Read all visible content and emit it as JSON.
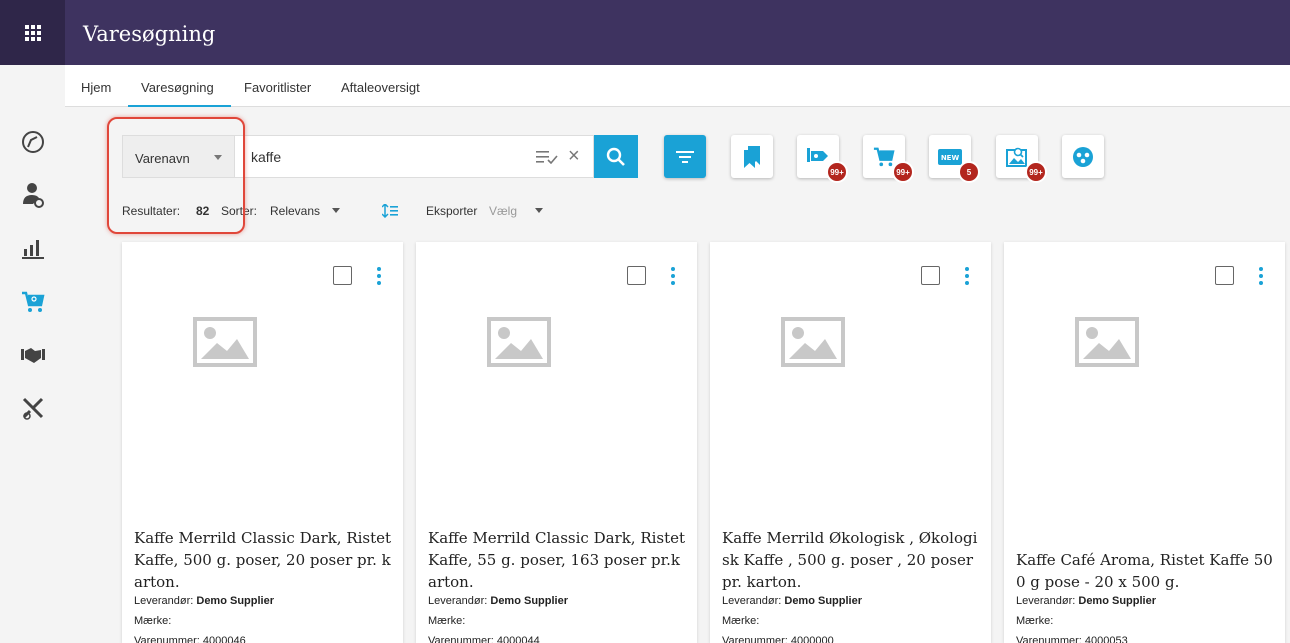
{
  "header": {
    "title": "Varesøgning"
  },
  "tabs": [
    {
      "label": "Hjem"
    },
    {
      "label": "Varesøgning"
    },
    {
      "label": "Favoritlister"
    },
    {
      "label": "Aftaleoversigt"
    }
  ],
  "search": {
    "field_select": "Varenavn",
    "query": "kaffe"
  },
  "results": {
    "label": "Resultater:",
    "count": "82",
    "sort_label": "Sorter:",
    "sort_value": "Relevans",
    "export_label": "Eksporter",
    "export_value": "Vælg"
  },
  "toolbar_badges": {
    "tag": "99+",
    "cart": "99+",
    "new": "5",
    "image_search": "99+"
  },
  "colors": {
    "header": "#3e3360",
    "accent": "#1aa2d6",
    "badge": "#b3261e",
    "highlight": "#e0473a"
  },
  "products": [
    {
      "title": "Kaffe Merrild Classic Dark, Ristet Kaffe, 500 g. poser, 20 poser pr. karton.",
      "supplier_label": "Leverandør:",
      "supplier": "Demo Supplier",
      "brand_label": "Mærke:",
      "item_no_label": "Varenummer:",
      "item_no": "4000046"
    },
    {
      "title": "Kaffe Merrild Classic Dark, Ristet Kaffe, 55 g. poser, 163 poser pr.karton.",
      "supplier_label": "Leverandør:",
      "supplier": "Demo Supplier",
      "brand_label": "Mærke:",
      "item_no_label": "Varenummer:",
      "item_no": "4000044"
    },
    {
      "title": "Kaffe Merrild Økologisk , Økologisk Kaffe , 500 g. poser , 20 poser pr. karton.",
      "supplier_label": "Leverandør:",
      "supplier": "Demo Supplier",
      "brand_label": "Mærke:",
      "item_no_label": "Varenummer:",
      "item_no": "4000000"
    },
    {
      "title": "Kaffe Café Aroma, Ristet Kaffe 500 g pose - 20 x 500 g.",
      "supplier_label": "Leverandør:",
      "supplier": "Demo Supplier",
      "brand_label": "Mærke:",
      "item_no_label": "Varenummer:",
      "item_no": "4000053"
    }
  ]
}
